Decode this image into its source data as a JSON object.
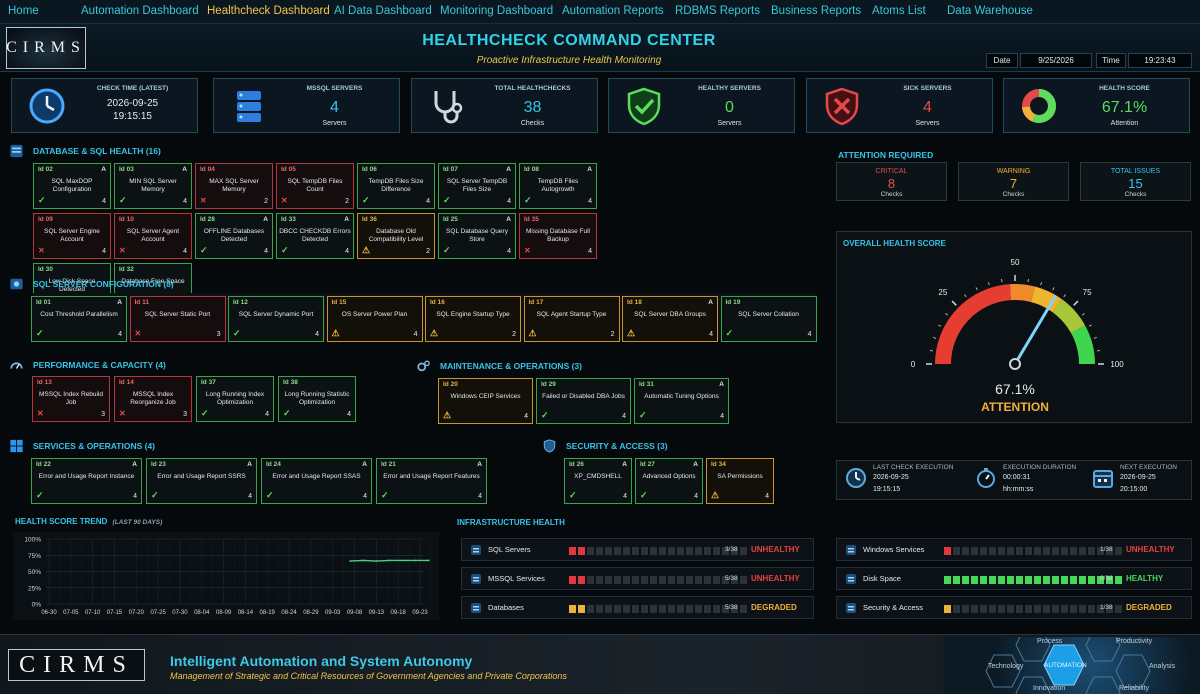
{
  "nav": {
    "items": [
      "Home",
      "Automation Dashboard",
      "Healthcheck Dashboard",
      "AI Data Dashboard",
      "Monitoring Dashboard",
      "Automation Reports",
      "RDBMS Reports",
      "Business Reports",
      "Atoms List",
      "Data Warehouse"
    ],
    "active": "Healthcheck Dashboard"
  },
  "header": {
    "logo": "CIRMS",
    "title": "HEALTHCHECK COMMAND CENTER",
    "subtitle": "Proactive Infrastructure Health Monitoring",
    "date_label": "Date",
    "date_value": "9/25/2026",
    "time_label": "Time",
    "time_value": "19:23:43"
  },
  "colors": {
    "green": "#5ddc5d",
    "red": "#e44a4a",
    "amber": "#f0b13a",
    "cyan": "#36c4e8",
    "gold": "#f0c64a"
  },
  "kpis": [
    {
      "title": "CHECK TIME (LATEST)",
      "line1": "2026-09-25",
      "line2": "19:15:15",
      "icon": "clock-icon",
      "color": "#e6ebee"
    },
    {
      "title": "MSSQL SERVERS",
      "value": "4",
      "sub": "Servers",
      "icon": "database-server-icon",
      "color": "#36c4e8"
    },
    {
      "title": "TOTAL HEALTHCHECKS",
      "value": "38",
      "sub": "Checks",
      "icon": "stethoscope-icon",
      "color": "#36c4e8"
    },
    {
      "title": "HEALTHY SERVERS",
      "value": "0",
      "sub": "Servers",
      "icon": "shield-check-icon",
      "color": "#5ddc5d"
    },
    {
      "title": "SICK SERVERS",
      "value": "4",
      "sub": "Servers",
      "icon": "shield-x-icon",
      "color": "#e44a4a"
    },
    {
      "title": "HEALTH SCORE",
      "value": "67.1%",
      "sub": "Attention",
      "icon": "donut-icon",
      "color": "#5ddc5d"
    }
  ],
  "sections": {
    "db": "DATABASE & SQL HEALTH (16)",
    "cfg": "SQL SERVER CONFIGURATION (8)",
    "perf": "PERFORMANCE & CAPACITY (4)",
    "maint": "MAINTENANCE & OPERATIONS (3)",
    "svc": "SERVICES & OPERATIONS (4)",
    "sec": "SECURITY & ACCESS (3)",
    "trend": "HEALTH SCORE TREND",
    "trend_sub": "(LAST 90 DAYS)",
    "infra": "INFRASTRUCTURE HEALTH",
    "attention": "ATTENTION REQUIRED",
    "overall": "OVERALL HEALTH SCORE"
  },
  "checks": {
    "db": [
      {
        "id": "Id 02",
        "tag": "A",
        "label": "SQL MaxDOP Configuration",
        "status": "ok",
        "n": "4"
      },
      {
        "id": "Id 03",
        "tag": "A",
        "label": "MIN SQL Server Memory",
        "status": "ok",
        "n": "4"
      },
      {
        "id": "Id 04",
        "tag": "",
        "label": "MAX SQL Server Memory",
        "status": "bad",
        "n": "2"
      },
      {
        "id": "Id 05",
        "tag": "",
        "label": "SQL TempDB Files Count",
        "status": "bad",
        "n": "2"
      },
      {
        "id": "Id 06",
        "tag": "",
        "label": "TempDB Files Size Difference",
        "status": "ok",
        "n": "4"
      },
      {
        "id": "Id 07",
        "tag": "A",
        "label": "SQL Server TempDB Files Size",
        "status": "ok",
        "n": "4"
      },
      {
        "id": "Id 08",
        "tag": "A",
        "label": "TempDB Files Autogrowth",
        "status": "ok",
        "n": "4"
      },
      {
        "id": "Id 09",
        "tag": "",
        "label": "SQL Server Engine Account",
        "status": "bad",
        "n": "4"
      },
      {
        "id": "Id 10",
        "tag": "",
        "label": "SQL Server Agent Account",
        "status": "bad",
        "n": "4"
      },
      {
        "id": "Id 28",
        "tag": "A",
        "label": "OFFLINE Databases Detected",
        "status": "ok",
        "n": "4"
      },
      {
        "id": "Id 33",
        "tag": "A",
        "label": "DBCC CHECKDB Errors Detected",
        "status": "ok",
        "n": "4"
      },
      {
        "id": "Id 36",
        "tag": "",
        "label": "Database Old Compatibility Level",
        "status": "warn",
        "n": "2"
      },
      {
        "id": "Id 25",
        "tag": "A",
        "label": "SQL Database Query Store",
        "status": "ok",
        "n": "4"
      },
      {
        "id": "Id 35",
        "tag": "",
        "label": "Missing Database Full Backup",
        "status": "bad",
        "n": "4"
      },
      {
        "id": "Id 30",
        "tag": "",
        "label": "Low Disk Space Detected",
        "status": "ok",
        "n": "4"
      },
      {
        "id": "Id 32",
        "tag": "",
        "label": "Database Free Space",
        "status": "none",
        "n": ""
      }
    ],
    "cfg": [
      {
        "id": "Id 01",
        "tag": "A",
        "label": "Cost Threshold Parallelism",
        "status": "ok",
        "n": "4"
      },
      {
        "id": "Id 11",
        "tag": "",
        "label": "SQL Server Static Port",
        "status": "bad",
        "n": "3"
      },
      {
        "id": "Id 12",
        "tag": "",
        "label": "SQL Server Dynamic Port",
        "status": "ok",
        "n": "4"
      },
      {
        "id": "Id 15",
        "tag": "",
        "label": "OS Server Power Plan",
        "status": "warn",
        "n": "4"
      },
      {
        "id": "Id 16",
        "tag": "",
        "label": "SQL Engine Startup Type",
        "status": "warn",
        "n": "2"
      },
      {
        "id": "Id 17",
        "tag": "",
        "label": "SQL Agent Startup Type",
        "status": "warn",
        "n": "2"
      },
      {
        "id": "Id 18",
        "tag": "A",
        "label": "SQL Server DBA Groups",
        "status": "warn",
        "n": "4"
      },
      {
        "id": "Id 19",
        "tag": "",
        "label": "SQL Server Collation",
        "status": "ok",
        "n": "4"
      }
    ],
    "perf": [
      {
        "id": "Id 13",
        "tag": "",
        "label": "MSSQL Index Rebuild Job",
        "status": "bad",
        "n": "3"
      },
      {
        "id": "Id 14",
        "tag": "",
        "label": "MSSQL Index Reorganize Job",
        "status": "bad",
        "n": "3"
      },
      {
        "id": "Id 37",
        "tag": "",
        "label": "Long Running Index Optimization",
        "status": "ok",
        "n": "4"
      },
      {
        "id": "Id 38",
        "tag": "",
        "label": "Long Running Statistic Optimization",
        "status": "ok",
        "n": "4"
      }
    ],
    "maint": [
      {
        "id": "Id 20",
        "tag": "",
        "label": "Windows CEIP Services",
        "status": "warn",
        "n": "4"
      },
      {
        "id": "Id 29",
        "tag": "",
        "label": "Failed or Disabled DBA Jobs",
        "status": "ok",
        "n": "4"
      },
      {
        "id": "Id 31",
        "tag": "A",
        "label": "Automatic Tuning Options",
        "status": "ok",
        "n": "4"
      }
    ],
    "svc": [
      {
        "id": "Id 22",
        "tag": "A",
        "label": "Error and Usage Report Instance",
        "status": "ok",
        "n": "4"
      },
      {
        "id": "Id 23",
        "tag": "A",
        "label": "Error and Usage Report SSRS",
        "status": "ok",
        "n": "4"
      },
      {
        "id": "Id 24",
        "tag": "A",
        "label": "Error and Usage Report SSAS",
        "status": "ok",
        "n": "4"
      },
      {
        "id": "Id 21",
        "tag": "A",
        "label": "Error and Usage Report Features",
        "status": "ok",
        "n": "4"
      }
    ],
    "sec": [
      {
        "id": "Id 26",
        "tag": "A",
        "label": "XP_CMDSHELL",
        "status": "ok",
        "n": "4"
      },
      {
        "id": "Id 27",
        "tag": "A",
        "label": "Advanced Options",
        "status": "ok",
        "n": "4"
      },
      {
        "id": "Id 34",
        "tag": "",
        "label": "SA Permissions",
        "status": "warn",
        "n": "4"
      }
    ]
  },
  "attention": [
    {
      "title": "CRITICAL",
      "value": "8",
      "sub": "Checks",
      "color": "#e44a4a"
    },
    {
      "title": "WARNING",
      "value": "7",
      "sub": "Checks",
      "color": "#f0b13a"
    },
    {
      "title": "TOTAL ISSUES",
      "value": "15",
      "sub": "Checks",
      "color": "#36c4e8"
    }
  ],
  "gauge": {
    "value": 67.1,
    "label": "67.1%",
    "status": "ATTENTION",
    "ticks": [
      "0",
      "25",
      "50",
      "75",
      "100"
    ]
  },
  "execution": [
    {
      "title": "LAST CHECK EXECUTION",
      "a": "2026-09-25",
      "b": "19:15:15",
      "icon": "clock-icon"
    },
    {
      "title": "EXECUTION DURATION",
      "a": "00:00:31",
      "b": "hh:mm:ss",
      "icon": "stopwatch-icon"
    },
    {
      "title": "NEXT EXECUTION",
      "a": "2026-09-25",
      "b": "20:15:00",
      "icon": "calendar-icon"
    }
  ],
  "chart_data": {
    "type": "line",
    "title": "HEALTH SCORE TREND",
    "x": [
      "06-30",
      "07-05",
      "07-10",
      "07-15",
      "07-20",
      "07-25",
      "07-30",
      "08-04",
      "08-09",
      "08-14",
      "08-19",
      "08-24",
      "08-29",
      "09-03",
      "09-08",
      "09-13",
      "09-18",
      "09-23"
    ],
    "ylim": [
      0,
      100
    ],
    "yticks": [
      "0%",
      "25%",
      "50%",
      "75%",
      "100%"
    ],
    "series": [
      {
        "points": [
          [
            "09-07",
            66
          ],
          [
            "09-10",
            67
          ],
          [
            "09-13",
            66
          ],
          [
            "09-16",
            67
          ],
          [
            "09-19",
            67
          ],
          [
            "09-22",
            67
          ],
          [
            "09-25",
            67
          ]
        ]
      }
    ],
    "grid": true
  },
  "infra": [
    {
      "name": "SQL Servers",
      "icon": "server-icon",
      "count": "3/38",
      "status": "UNHEALTHY",
      "bars": [
        "r",
        "r",
        "d",
        "d",
        "d",
        "d",
        "d",
        "d",
        "d",
        "d",
        "d",
        "d",
        "d",
        "d",
        "d",
        "d",
        "d",
        "d",
        "d",
        "d"
      ]
    },
    {
      "name": "Windows Services",
      "icon": "windows-icon",
      "count": "1/38",
      "status": "UNHEALTHY",
      "bars": [
        "r",
        "d",
        "d",
        "d",
        "d",
        "d",
        "d",
        "d",
        "d",
        "d",
        "d",
        "d",
        "d",
        "d",
        "d",
        "d",
        "d",
        "d",
        "d",
        "d"
      ]
    },
    {
      "name": "MSSQL Services",
      "icon": "gear-icon",
      "count": "5/38",
      "status": "UNHEALTHY",
      "bars": [
        "r",
        "r",
        "d",
        "d",
        "d",
        "d",
        "d",
        "d",
        "d",
        "d",
        "d",
        "d",
        "d",
        "d",
        "d",
        "d",
        "d",
        "d",
        "d",
        "d"
      ]
    },
    {
      "name": "Disk Space",
      "icon": "disk-icon",
      "count": "0/38",
      "status": "HEALTHY",
      "bars": [
        "g",
        "g",
        "g",
        "g",
        "g",
        "g",
        "g",
        "g",
        "g",
        "g",
        "g",
        "g",
        "g",
        "g",
        "g",
        "g",
        "g",
        "g",
        "g",
        "g"
      ]
    },
    {
      "name": "Databases",
      "icon": "database-icon",
      "count": "5/38",
      "status": "DEGRADED",
      "bars": [
        "y",
        "y",
        "d",
        "d",
        "d",
        "d",
        "d",
        "d",
        "d",
        "d",
        "d",
        "d",
        "d",
        "d",
        "d",
        "d",
        "d",
        "d",
        "d",
        "d"
      ]
    },
    {
      "name": "Security & Access",
      "icon": "shield-icon",
      "count": "1/38",
      "status": "DEGRADED",
      "bars": [
        "y",
        "d",
        "d",
        "d",
        "d",
        "d",
        "d",
        "d",
        "d",
        "d",
        "d",
        "d",
        "d",
        "d",
        "d",
        "d",
        "d",
        "d",
        "d",
        "d"
      ]
    }
  ],
  "footer": {
    "logo": "CIRMS",
    "title": "Intelligent Automation and System Autonomy",
    "subtitle": "Management of Strategic and Critical Resources of Government Agencies and Private Corporations",
    "hex_labels": [
      "Process",
      "Productivity",
      "Technology",
      "AUTOMATION",
      "Analysis",
      "Innovation",
      "Reliability"
    ]
  }
}
